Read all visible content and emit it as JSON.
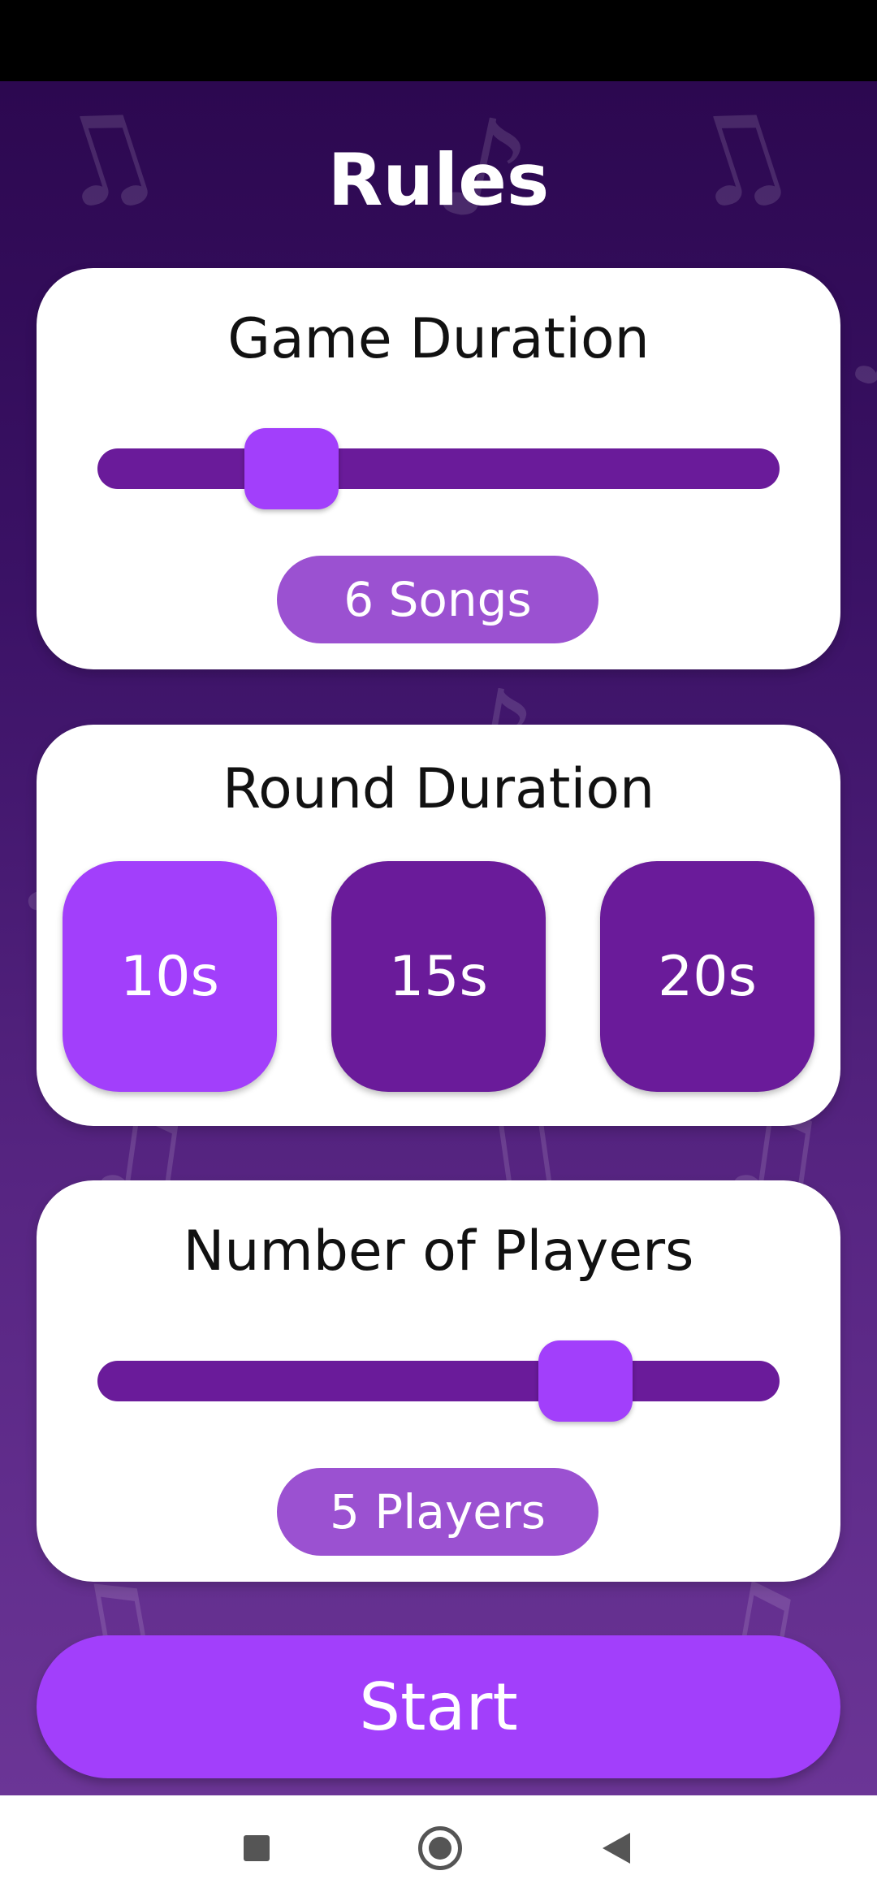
{
  "header": {
    "title": "Rules"
  },
  "game_duration": {
    "title": "Game Duration",
    "value_label": "6 Songs",
    "slider_level": 0.25
  },
  "round_duration": {
    "title": "Round Duration",
    "options": [
      {
        "label": "10s",
        "selected": true
      },
      {
        "label": "15s",
        "selected": false
      },
      {
        "label": "20s",
        "selected": false
      }
    ]
  },
  "players": {
    "title": "Number of Players",
    "value_label": "5 Players",
    "slider_level": 0.75
  },
  "actions": {
    "start_label": "Start"
  },
  "colors": {
    "accent": "#a23ffb",
    "track": "#6a1b9a",
    "pill": "#9b51d1",
    "background_top": "#2c0850",
    "background_bottom": "#6b3596"
  },
  "icons": {
    "background": "music-note-icon",
    "nav": [
      "recents-icon",
      "home-icon",
      "back-icon"
    ]
  }
}
